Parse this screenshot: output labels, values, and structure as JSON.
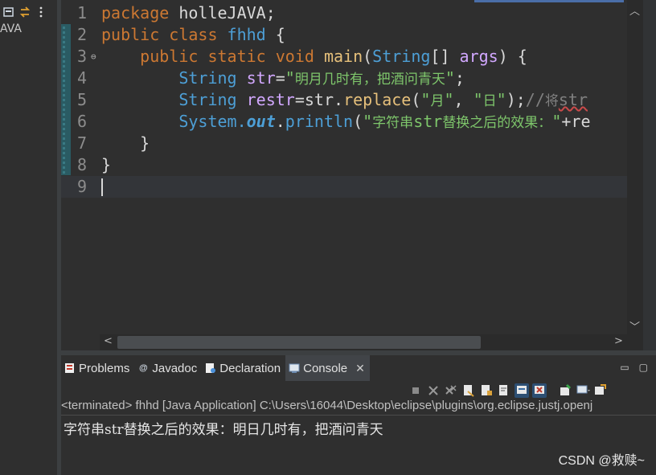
{
  "explorer": {
    "label": "AVA",
    "icons": [
      "collapse-all-icon",
      "link-with-editor-icon",
      "view-menu-icon"
    ]
  },
  "editor": {
    "lines": [
      {
        "n": "1",
        "tokens": [
          [
            "kw",
            "package "
          ],
          [
            "pl",
            "holleJAVA;"
          ]
        ]
      },
      {
        "n": "2",
        "tokens": [
          [
            "kw",
            "public class "
          ],
          [
            "ty",
            "fhhd"
          ],
          [
            "pl",
            " {"
          ]
        ]
      },
      {
        "n": "3",
        "fold": "⊖",
        "tokens": [
          [
            "pl",
            "    "
          ],
          [
            "kw",
            "public static void "
          ],
          [
            "fn",
            "main"
          ],
          [
            "pl",
            "("
          ],
          [
            "ty",
            "String"
          ],
          [
            "pl",
            "[] "
          ],
          [
            "va",
            "args"
          ],
          [
            "pl",
            ") {"
          ]
        ]
      },
      {
        "n": "4",
        "tokens": [
          [
            "pl",
            "        "
          ],
          [
            "ty",
            "String "
          ],
          [
            "va",
            "str"
          ],
          [
            "pl",
            "="
          ],
          [
            "str",
            "\""
          ],
          [
            "strc",
            "明月几时有，把酒问青天"
          ],
          [
            "str",
            "\""
          ],
          [
            "pl",
            ";"
          ]
        ]
      },
      {
        "n": "5",
        "tokens": [
          [
            "pl",
            "        "
          ],
          [
            "ty",
            "String "
          ],
          [
            "va",
            "restr"
          ],
          [
            "pl",
            "=str."
          ],
          [
            "fn",
            "replace"
          ],
          [
            "pl",
            "("
          ],
          [
            "str",
            "\""
          ],
          [
            "strc",
            "月"
          ],
          [
            "str",
            "\""
          ],
          [
            "pl",
            ", "
          ],
          [
            "str",
            "\""
          ],
          [
            "strc",
            "日"
          ],
          [
            "str",
            "\""
          ],
          [
            "pl",
            ");"
          ],
          [
            "cm",
            "//"
          ],
          [
            "cmc",
            "将"
          ],
          [
            "cmsq",
            "str"
          ]
        ]
      },
      {
        "n": "6",
        "tokens": [
          [
            "pl",
            "        "
          ],
          [
            "ty",
            "System."
          ],
          [
            "it",
            "out"
          ],
          [
            "pl",
            "."
          ],
          [
            "ty",
            "println"
          ],
          [
            "pl",
            "("
          ],
          [
            "str",
            "\""
          ],
          [
            "strc",
            "字符串"
          ],
          [
            "str",
            "str"
          ],
          [
            "strc",
            "替换之后的效果："
          ],
          [
            "str",
            "\""
          ],
          [
            "pl",
            "+re"
          ]
        ]
      },
      {
        "n": "7",
        "tokens": [
          [
            "pl",
            "    }"
          ]
        ]
      },
      {
        "n": "8",
        "tokens": [
          [
            "pl",
            "}"
          ]
        ]
      },
      {
        "n": "9",
        "tokens": [],
        "current": true
      }
    ]
  },
  "panel": {
    "tabs": [
      {
        "label": "Problems",
        "icon": "problems-icon"
      },
      {
        "label": "Javadoc",
        "icon": "javadoc-icon"
      },
      {
        "label": "Declaration",
        "icon": "declaration-icon"
      },
      {
        "label": "Console",
        "icon": "console-icon",
        "active": true
      }
    ],
    "console_header": "<terminated> fhhd [Java Application] C:\\Users\\16044\\Desktop\\eclipse\\plugins\\org.eclipse.justj.openj",
    "console_output": "字符串str替换之后的效果：明日几时有，把酒问青天"
  },
  "watermark": "CSDN @救赎~",
  "colors": {
    "keyword": "#cc7832",
    "type": "#4d9fd6",
    "string": "#7ec66b",
    "method": "#e6c07b",
    "variable": "#d2a8ff",
    "accent": "#4a6ea8"
  }
}
